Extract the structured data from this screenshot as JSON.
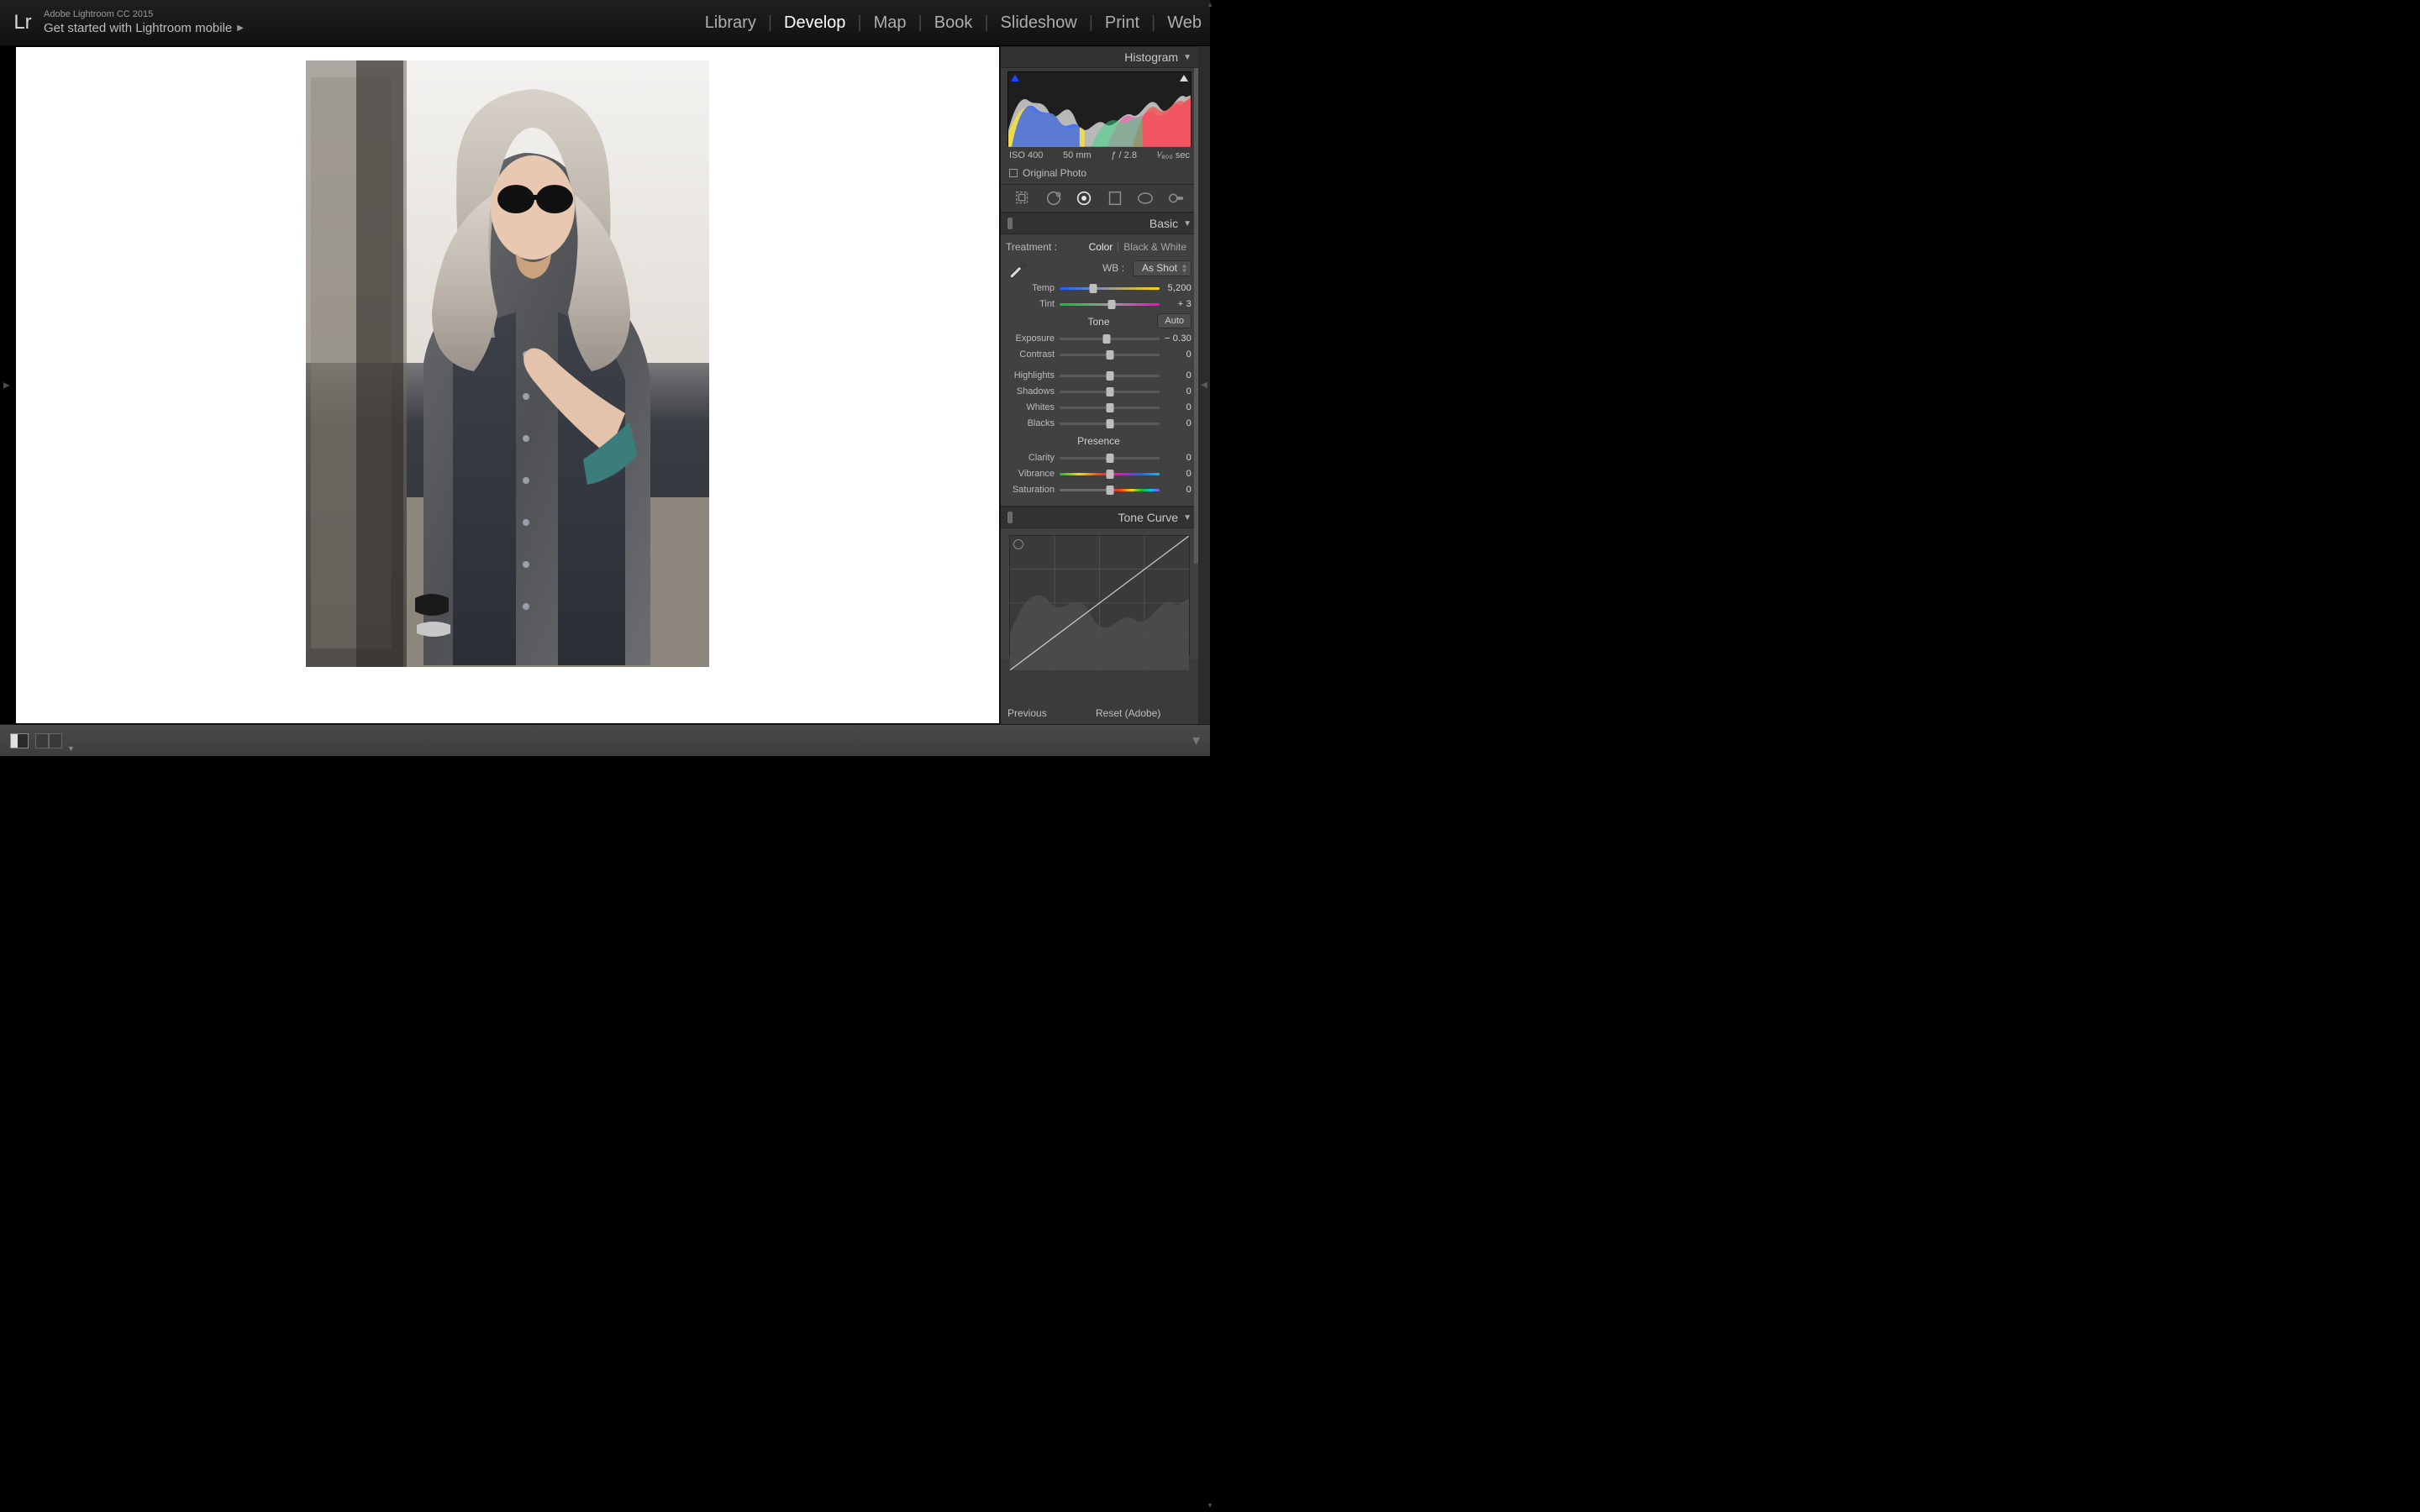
{
  "header": {
    "logo_text": "Lr",
    "app_title": "Adobe Lightroom CC 2015",
    "sub_title": "Get started with Lightroom mobile",
    "modules": {
      "library": "Library",
      "develop": "Develop",
      "map": "Map",
      "book": "Book",
      "slideshow": "Slideshow",
      "print": "Print",
      "web": "Web"
    }
  },
  "panels": {
    "histogram": {
      "title": "Histogram",
      "meta": {
        "iso": "ISO 400",
        "focal": "50 mm",
        "aperture": "ƒ / 2.8",
        "shutter": "¹⁄₈₀₀ sec"
      },
      "original_label": "Original Photo"
    },
    "basic": {
      "title": "Basic",
      "treatment_label": "Treatment :",
      "treatment_color": "Color",
      "treatment_bw": "Black & White",
      "wb_label": "WB :",
      "wb_value": "As Shot",
      "temp_label": "Temp",
      "temp_value": "5,200",
      "tint_label": "Tint",
      "tint_value": "+ 3",
      "tone_header": "Tone",
      "auto_label": "Auto",
      "exposure_label": "Exposure",
      "exposure_value": "− 0.30",
      "contrast_label": "Contrast",
      "contrast_value": "0",
      "highlights_label": "Highlights",
      "highlights_value": "0",
      "shadows_label": "Shadows",
      "shadows_value": "0",
      "whites_label": "Whites",
      "whites_value": "0",
      "blacks_label": "Blacks",
      "blacks_value": "0",
      "presence_header": "Presence",
      "clarity_label": "Clarity",
      "clarity_value": "0",
      "vibrance_label": "Vibrance",
      "vibrance_value": "0",
      "saturation_label": "Saturation",
      "saturation_value": "0"
    },
    "tonecurve": {
      "title": "Tone Curve"
    }
  },
  "footer": {
    "previous": "Previous",
    "reset": "Reset (Adobe)"
  },
  "slider_pos": {
    "temp": 34,
    "tint": 52,
    "exposure": 47,
    "contrast": 50,
    "highlights": 50,
    "shadows": 50,
    "whites": 50,
    "blacks": 50,
    "clarity": 50,
    "vibrance": 50,
    "saturation": 50
  }
}
